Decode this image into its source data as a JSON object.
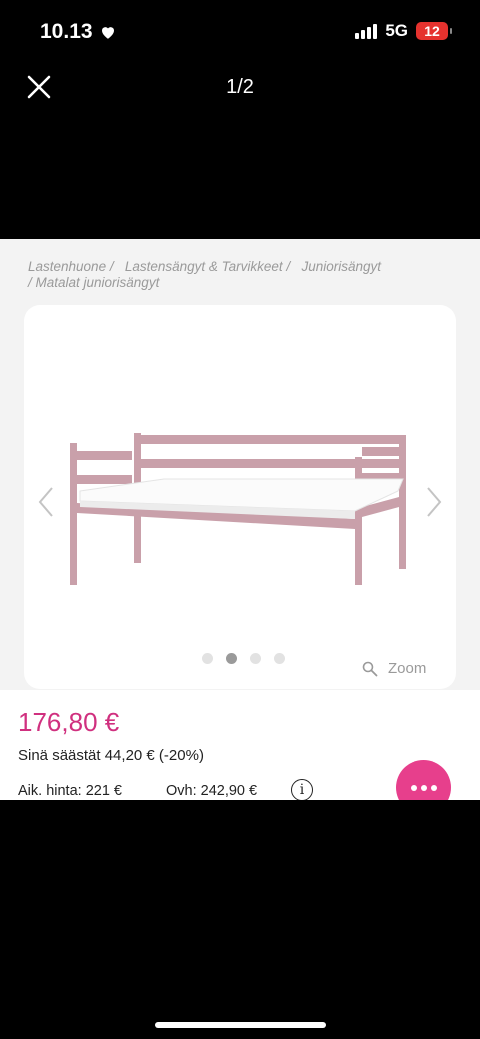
{
  "status_bar": {
    "time": "10.13",
    "network": "5G",
    "battery": "12"
  },
  "viewer": {
    "counter": "1/2"
  },
  "breadcrumb": {
    "items": [
      "Lastenhuone /",
      "Lastensängyt & Tarvikkeet /",
      "Juniorisängyt",
      "/  Matalat juniorisängyt"
    ]
  },
  "product": {
    "carousel_dot_count": 4,
    "active_dot": 2,
    "zoom_label": "Zoom",
    "price": "176,80 €",
    "savings": "Sinä säästät 44,20 € (-20%)",
    "previous_price": "Aik. hinta: 221 €",
    "rrp": "Ovh: 242,90 €",
    "info_icon_label": "i",
    "bed_color": "#c9a0aa"
  },
  "colors": {
    "accent": "#e73f8c",
    "price": "#d0307f"
  }
}
